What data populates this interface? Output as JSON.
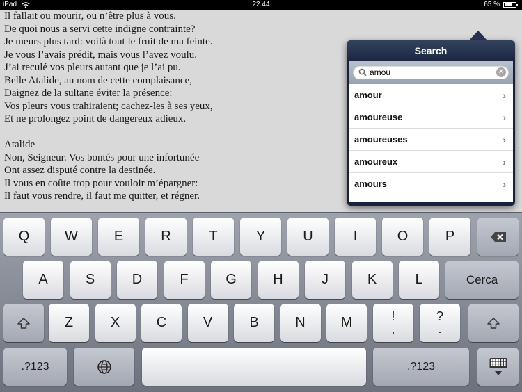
{
  "status_bar": {
    "device": "iPad",
    "time": "22.44",
    "battery_percent": "65 %",
    "battery_level": 0.65
  },
  "document": {
    "lines": [
      "Il fallait ou mourir, ou n’être plus à vous.",
      "De quoi nous a servi cette indigne contrainte?",
      "Je meurs plus tard: voilà tout le fruit de ma feinte.",
      "Je vous l’avais prédit, mais vous l’avez voulu.",
      "J’ai reculé vos pleurs autant que je l’ai pu.",
      "Belle Atalide, au nom de cette complaisance,",
      "Daignez de la sultane éviter la présence:",
      "Vos pleurs vous trahiraient; cachez-les à ses yeux,",
      "Et ne prolongez point de dangereux adieux.",
      "",
      "Atalide",
      "Non, Seigneur. Vos bontés pour une infortunée",
      "Ont assez disputé contre la destinée.",
      "Il vous en coûte trop pour vouloir m’épargner:",
      "Il faut vous rendre, il faut me quitter, et régner."
    ]
  },
  "search_popover": {
    "title": "Search",
    "query": "amou",
    "results": [
      "amour",
      "amoureuse",
      "amoureuses",
      "amoureux",
      "amours"
    ]
  },
  "keyboard": {
    "row1": [
      "Q",
      "W",
      "E",
      "R",
      "T",
      "Y",
      "U",
      "I",
      "O",
      "P"
    ],
    "row2": [
      "A",
      "S",
      "D",
      "F",
      "G",
      "H",
      "J",
      "K",
      "L"
    ],
    "row3": [
      "Z",
      "X",
      "C",
      "V",
      "B",
      "N",
      "M"
    ],
    "return_label": "Cerca",
    "numbers_label": ".?123",
    "punct1_top": "!",
    "punct1_bottom": ",",
    "punct2_top": "?",
    "punct2_bottom": "."
  }
}
